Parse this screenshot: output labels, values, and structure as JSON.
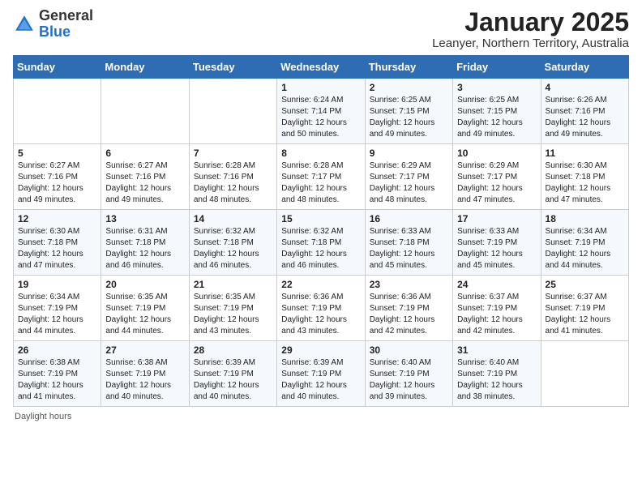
{
  "header": {
    "logo_general": "General",
    "logo_blue": "Blue",
    "title": "January 2025",
    "subtitle": "Leanyer, Northern Territory, Australia"
  },
  "footer": {
    "daylight_label": "Daylight hours"
  },
  "weekdays": [
    "Sunday",
    "Monday",
    "Tuesday",
    "Wednesday",
    "Thursday",
    "Friday",
    "Saturday"
  ],
  "weeks": [
    [
      {
        "day": "",
        "detail": ""
      },
      {
        "day": "",
        "detail": ""
      },
      {
        "day": "",
        "detail": ""
      },
      {
        "day": "1",
        "detail": "Sunrise: 6:24 AM\nSunset: 7:14 PM\nDaylight: 12 hours\nand 50 minutes."
      },
      {
        "day": "2",
        "detail": "Sunrise: 6:25 AM\nSunset: 7:15 PM\nDaylight: 12 hours\nand 49 minutes."
      },
      {
        "day": "3",
        "detail": "Sunrise: 6:25 AM\nSunset: 7:15 PM\nDaylight: 12 hours\nand 49 minutes."
      },
      {
        "day": "4",
        "detail": "Sunrise: 6:26 AM\nSunset: 7:16 PM\nDaylight: 12 hours\nand 49 minutes."
      }
    ],
    [
      {
        "day": "5",
        "detail": "Sunrise: 6:27 AM\nSunset: 7:16 PM\nDaylight: 12 hours\nand 49 minutes."
      },
      {
        "day": "6",
        "detail": "Sunrise: 6:27 AM\nSunset: 7:16 PM\nDaylight: 12 hours\nand 49 minutes."
      },
      {
        "day": "7",
        "detail": "Sunrise: 6:28 AM\nSunset: 7:16 PM\nDaylight: 12 hours\nand 48 minutes."
      },
      {
        "day": "8",
        "detail": "Sunrise: 6:28 AM\nSunset: 7:17 PM\nDaylight: 12 hours\nand 48 minutes."
      },
      {
        "day": "9",
        "detail": "Sunrise: 6:29 AM\nSunset: 7:17 PM\nDaylight: 12 hours\nand 48 minutes."
      },
      {
        "day": "10",
        "detail": "Sunrise: 6:29 AM\nSunset: 7:17 PM\nDaylight: 12 hours\nand 47 minutes."
      },
      {
        "day": "11",
        "detail": "Sunrise: 6:30 AM\nSunset: 7:18 PM\nDaylight: 12 hours\nand 47 minutes."
      }
    ],
    [
      {
        "day": "12",
        "detail": "Sunrise: 6:30 AM\nSunset: 7:18 PM\nDaylight: 12 hours\nand 47 minutes."
      },
      {
        "day": "13",
        "detail": "Sunrise: 6:31 AM\nSunset: 7:18 PM\nDaylight: 12 hours\nand 46 minutes."
      },
      {
        "day": "14",
        "detail": "Sunrise: 6:32 AM\nSunset: 7:18 PM\nDaylight: 12 hours\nand 46 minutes."
      },
      {
        "day": "15",
        "detail": "Sunrise: 6:32 AM\nSunset: 7:18 PM\nDaylight: 12 hours\nand 46 minutes."
      },
      {
        "day": "16",
        "detail": "Sunrise: 6:33 AM\nSunset: 7:18 PM\nDaylight: 12 hours\nand 45 minutes."
      },
      {
        "day": "17",
        "detail": "Sunrise: 6:33 AM\nSunset: 7:19 PM\nDaylight: 12 hours\nand 45 minutes."
      },
      {
        "day": "18",
        "detail": "Sunrise: 6:34 AM\nSunset: 7:19 PM\nDaylight: 12 hours\nand 44 minutes."
      }
    ],
    [
      {
        "day": "19",
        "detail": "Sunrise: 6:34 AM\nSunset: 7:19 PM\nDaylight: 12 hours\nand 44 minutes."
      },
      {
        "day": "20",
        "detail": "Sunrise: 6:35 AM\nSunset: 7:19 PM\nDaylight: 12 hours\nand 44 minutes."
      },
      {
        "day": "21",
        "detail": "Sunrise: 6:35 AM\nSunset: 7:19 PM\nDaylight: 12 hours\nand 43 minutes."
      },
      {
        "day": "22",
        "detail": "Sunrise: 6:36 AM\nSunset: 7:19 PM\nDaylight: 12 hours\nand 43 minutes."
      },
      {
        "day": "23",
        "detail": "Sunrise: 6:36 AM\nSunset: 7:19 PM\nDaylight: 12 hours\nand 42 minutes."
      },
      {
        "day": "24",
        "detail": "Sunrise: 6:37 AM\nSunset: 7:19 PM\nDaylight: 12 hours\nand 42 minutes."
      },
      {
        "day": "25",
        "detail": "Sunrise: 6:37 AM\nSunset: 7:19 PM\nDaylight: 12 hours\nand 41 minutes."
      }
    ],
    [
      {
        "day": "26",
        "detail": "Sunrise: 6:38 AM\nSunset: 7:19 PM\nDaylight: 12 hours\nand 41 minutes."
      },
      {
        "day": "27",
        "detail": "Sunrise: 6:38 AM\nSunset: 7:19 PM\nDaylight: 12 hours\nand 40 minutes."
      },
      {
        "day": "28",
        "detail": "Sunrise: 6:39 AM\nSunset: 7:19 PM\nDaylight: 12 hours\nand 40 minutes."
      },
      {
        "day": "29",
        "detail": "Sunrise: 6:39 AM\nSunset: 7:19 PM\nDaylight: 12 hours\nand 40 minutes."
      },
      {
        "day": "30",
        "detail": "Sunrise: 6:40 AM\nSunset: 7:19 PM\nDaylight: 12 hours\nand 39 minutes."
      },
      {
        "day": "31",
        "detail": "Sunrise: 6:40 AM\nSunset: 7:19 PM\nDaylight: 12 hours\nand 38 minutes."
      },
      {
        "day": "",
        "detail": ""
      }
    ]
  ]
}
